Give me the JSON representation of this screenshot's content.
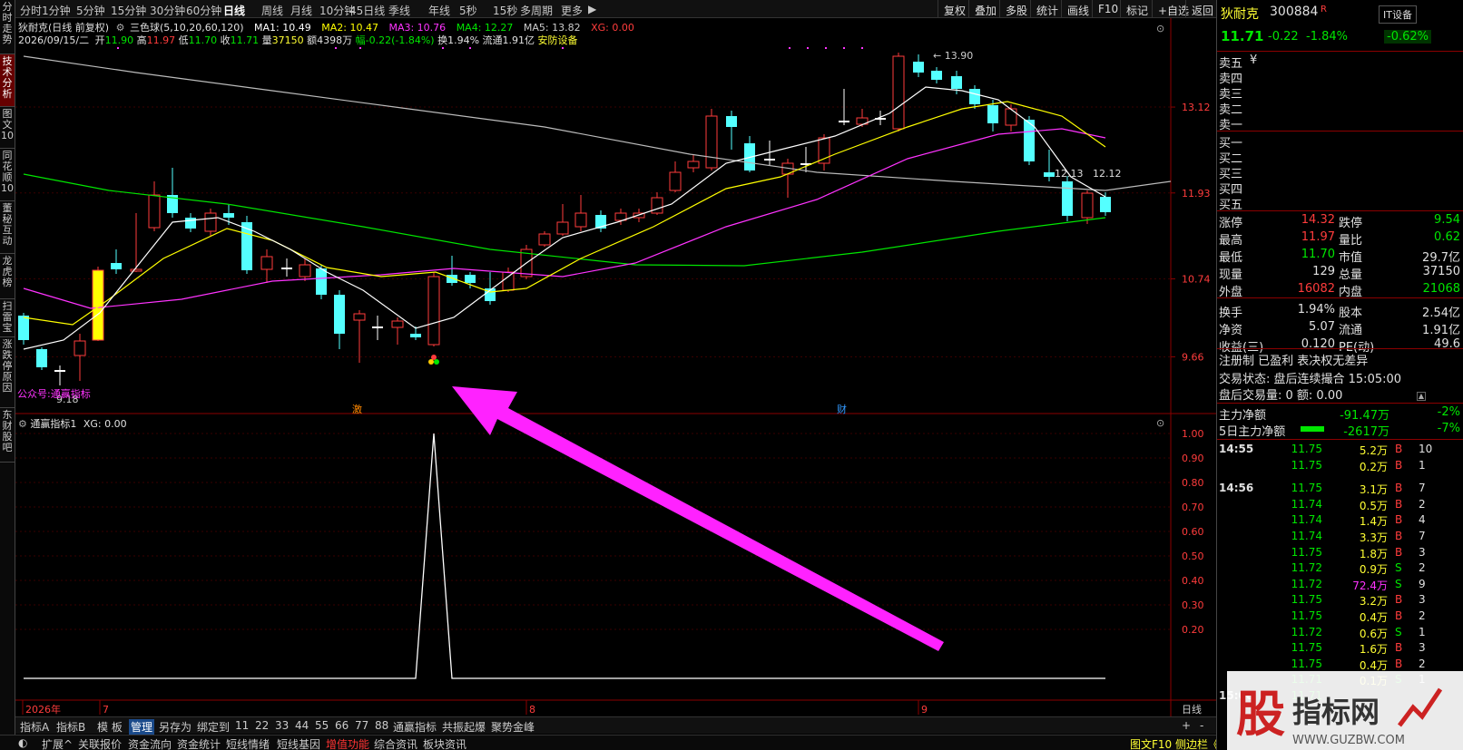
{
  "topbar": {
    "periods": [
      "分时",
      "1分钟",
      "5分钟",
      "15分钟",
      "30分钟",
      "60分钟",
      "日线",
      "周线",
      "月线",
      "10分钟",
      "45日线",
      "季线",
      "年线",
      "5秒",
      "15秒",
      "多周期",
      "更多"
    ],
    "active_period": "日线",
    "buttons": [
      "复权",
      "叠加",
      "多股",
      "统计",
      "画线",
      "F10",
      "标记",
      "+自选",
      "返回"
    ]
  },
  "lefttabs": [
    "分时走势",
    "技术分析",
    "图文10",
    "同花顺10",
    "董秘互动",
    "龙虎榜",
    "扫雷宝",
    "涨跌停原因",
    "东财股吧"
  ],
  "lefttabs_active": "技术分析",
  "chart": {
    "title_line": "狄耐克(日线 前复权)",
    "indicator_name": "三色球(5,10,20,60,120)",
    "ma1": "MA1: 10.49",
    "ma2": "MA2: 10.47",
    "ma3": "MA3: 10.76",
    "ma4": "MA4: 12.27",
    "ma5": "MA5: 13.82",
    "xg": "XG: 0.00",
    "info_date": "2026/09/15/二",
    "info_open_label": "开",
    "info_open": "11.90",
    "info_high_label": "高",
    "info_high": "11.97",
    "info_low_label": "低",
    "info_low": "11.70",
    "info_close_label": "收",
    "info_close": "11.71",
    "info_vol_label": "量",
    "info_vol": "37150",
    "info_amt": "额4398万",
    "info_chg": "幅-0.22(-1.84%)",
    "info_turn": "换1.94%",
    "info_float": "流通1.91亿",
    "info_sector": "安防设备",
    "price_axis": [
      "13.12",
      "11.93",
      "10.74",
      "9.66"
    ],
    "high_label": "13.90",
    "low_label": "9.18",
    "last_labels": [
      "12.13",
      "12.12"
    ],
    "watermark_text": "公众号:通赢指标",
    "marker_1": "激",
    "marker_2": "财",
    "sub_title": "通赢指标1",
    "sub_xg": "XG: 0.00",
    "sub_axis": [
      "1.00",
      "0.90",
      "0.80",
      "0.70",
      "0.60",
      "0.50",
      "0.40",
      "0.30",
      "0.20"
    ],
    "date_labels": [
      "2026年",
      "7",
      "8",
      "9"
    ],
    "period_label": "日线"
  },
  "bottom_tabs": [
    "指标A",
    "指标B",
    "模 板",
    "管理",
    "另存为",
    "绑定到",
    "11",
    "22",
    "33",
    "44",
    "55",
    "66",
    "77",
    "88",
    "通赢指标",
    "共振起爆",
    "聚势金峰"
  ],
  "bottom_active": "管理",
  "statusbar": [
    "扩展^",
    "关联报价",
    "资金流向",
    "资金统计",
    "短线情绪",
    "短线基因",
    "增值功能",
    "综合资讯",
    "板块资讯"
  ],
  "statusbar_right": "图文F10 侧边栏《",
  "quote": {
    "name": "狄耐克",
    "code": "300884",
    "r_flag": "R",
    "sector_btn": "IT设备",
    "sector_chg": "-0.62%",
    "price": "11.71",
    "chg": "-0.22",
    "pct": "-1.84%",
    "sell_levels": [
      "卖五",
      "卖四",
      "卖三",
      "卖二",
      "卖一"
    ],
    "buy_levels": [
      "买一",
      "买二",
      "买三",
      "买四",
      "买五"
    ],
    "yen": "¥",
    "stats": [
      {
        "l1": "涨停",
        "v1": "14.32",
        "c1": "red",
        "l2": "跌停",
        "v2": "9.54",
        "c2": "green"
      },
      {
        "l1": "最高",
        "v1": "11.97",
        "c1": "red",
        "l2": "量比",
        "v2": "0.62",
        "c2": "green"
      },
      {
        "l1": "最低",
        "v1": "11.70",
        "c1": "green",
        "l2": "市值",
        "v2": "29.7亿",
        "c2": "white"
      },
      {
        "l1": "现量",
        "v1": "129",
        "c1": "white",
        "l2": "总量",
        "v2": "37150",
        "c2": "white"
      },
      {
        "l1": "外盘",
        "v1": "16082",
        "c1": "red",
        "l2": "内盘",
        "v2": "21068",
        "c2": "green"
      },
      {
        "l1": "换手",
        "v1": "1.94%",
        "c1": "white",
        "l2": "股本",
        "v2": "2.54亿",
        "c2": "white"
      },
      {
        "l1": "净资",
        "v1": "5.07",
        "c1": "white",
        "l2": "流通",
        "v2": "1.91亿",
        "c2": "white"
      },
      {
        "l1": "收益(三)",
        "v1": "0.120",
        "c1": "white",
        "l2": "PE(动)",
        "v2": "49.6",
        "c2": "white"
      }
    ],
    "reg_line": "注册制 已盈利 表决权无差异",
    "trade_status": "交易状态: 盘后连续撮合 15:05:00",
    "after_vol": "盘后交易量: 0  额: 0.00",
    "main_net_label": "主力净额",
    "main_net_val": "-91.47万",
    "main_net_pct": "-2%",
    "main5_label": "5日主力净额",
    "main5_val": "-2617万",
    "main5_pct": "-7%",
    "ticks": [
      {
        "t": "14:55",
        "p": "11.75",
        "v": "5.2万",
        "s": "B",
        "n": "10"
      },
      {
        "t": "",
        "p": "11.75",
        "v": "0.2万",
        "s": "B",
        "n": "1"
      },
      {
        "t": "14:56",
        "p": "11.75",
        "v": "3.1万",
        "s": "B",
        "n": "7"
      },
      {
        "t": "",
        "p": "11.74",
        "v": "0.5万",
        "s": "B",
        "n": "2"
      },
      {
        "t": "",
        "p": "11.74",
        "v": "1.4万",
        "s": "B",
        "n": "4"
      },
      {
        "t": "",
        "p": "11.74",
        "v": "3.3万",
        "s": "B",
        "n": "7"
      },
      {
        "t": "",
        "p": "11.75",
        "v": "1.8万",
        "s": "B",
        "n": "3"
      },
      {
        "t": "",
        "p": "11.72",
        "v": "0.9万",
        "s": "S",
        "n": "2"
      },
      {
        "t": "",
        "p": "11.72",
        "v": "72.4万",
        "s": "S",
        "n": "9"
      },
      {
        "t": "",
        "p": "11.75",
        "v": "3.2万",
        "s": "B",
        "n": "3"
      },
      {
        "t": "",
        "p": "11.75",
        "v": "0.4万",
        "s": "B",
        "n": "2"
      },
      {
        "t": "",
        "p": "11.72",
        "v": "0.6万",
        "s": "S",
        "n": "1"
      },
      {
        "t": "",
        "p": "11.75",
        "v": "1.6万",
        "s": "B",
        "n": "3"
      },
      {
        "t": "",
        "p": "11.75",
        "v": "0.4万",
        "s": "B",
        "n": "2"
      },
      {
        "t": "",
        "p": "11.71",
        "v": "0.1万",
        "s": "S",
        "n": "1"
      },
      {
        "t": "15:00",
        "p": "11.71",
        "v": "",
        "s": "",
        "n": ""
      }
    ]
  },
  "colors": {
    "up": "#ff3c3c",
    "down": "#54ffff",
    "ma5": "#ffffff",
    "ma10": "#ffff00",
    "ma20": "#ff33ff",
    "ma60": "#00e600",
    "ma120": "#bbbbbb",
    "arrow": "#ff22ff"
  }
}
